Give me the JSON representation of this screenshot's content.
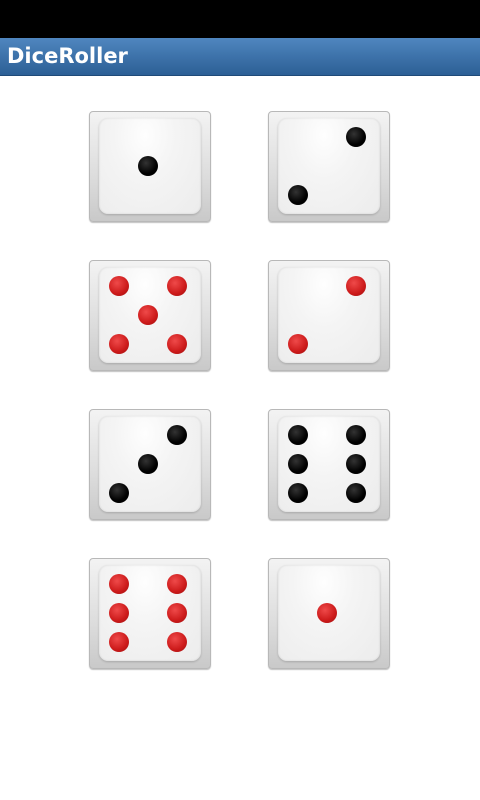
{
  "app": {
    "title": "DiceRoller"
  },
  "dice": [
    {
      "value": 1,
      "color": "#000000"
    },
    {
      "value": 2,
      "color": "#000000"
    },
    {
      "value": 5,
      "color": "#cc1a1a"
    },
    {
      "value": 2,
      "color": "#cc1a1a"
    },
    {
      "value": 3,
      "color": "#000000"
    },
    {
      "value": 6,
      "color": "#000000"
    },
    {
      "value": 6,
      "color": "#cc1a1a"
    },
    {
      "value": 1,
      "color": "#cc1a1a"
    }
  ]
}
